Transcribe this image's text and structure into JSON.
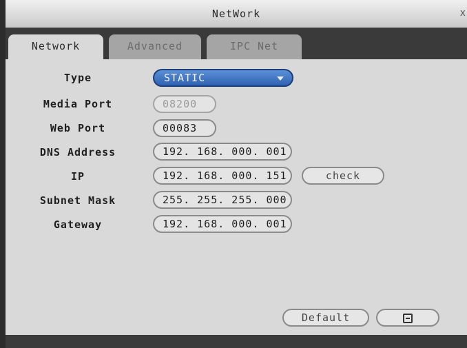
{
  "window": {
    "title": "NetWork",
    "close_glyph": "x"
  },
  "tabs": [
    {
      "label": "Network",
      "active": true
    },
    {
      "label": "Advanced",
      "active": false
    },
    {
      "label": "IPC Net",
      "active": false
    }
  ],
  "form": {
    "type": {
      "label": "Type",
      "value": "STATIC"
    },
    "media_port": {
      "label": "Media Port",
      "value": "08200",
      "disabled": true
    },
    "web_port": {
      "label": "Web Port",
      "value": "00083"
    },
    "dns_address": {
      "label": "DNS Address",
      "value": "192. 168. 000. 001"
    },
    "ip": {
      "label": "IP",
      "value": "192. 168. 000. 151",
      "check_label": "check"
    },
    "subnet_mask": {
      "label": "Subnet Mask",
      "value": "255. 255. 255. 000"
    },
    "gateway": {
      "label": "Gateway",
      "value": "192. 168. 000. 001"
    }
  },
  "footer": {
    "default_label": "Default",
    "save_icon": "floppy-save-icon"
  },
  "colors": {
    "dropdown_accent": "#3f74c4",
    "panel_bg": "#d9d9d9",
    "tab_bar_bg": "#3a3a3a"
  }
}
